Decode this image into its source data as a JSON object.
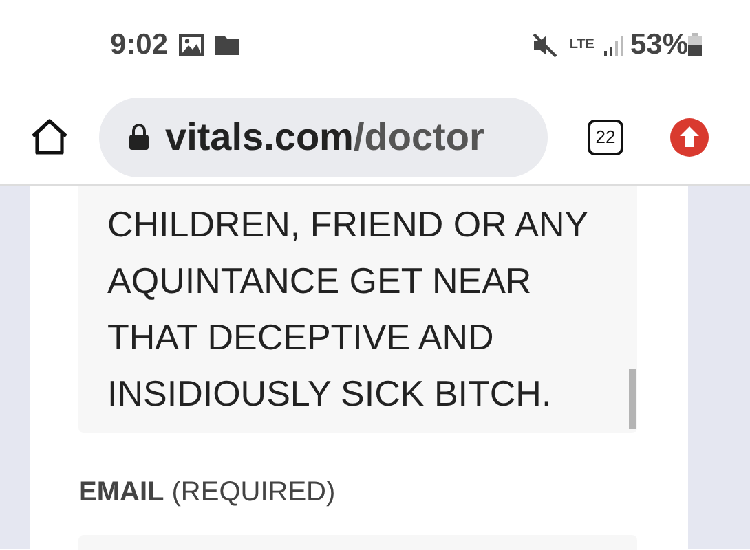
{
  "status_bar": {
    "time": "9:02",
    "network": "LTE",
    "battery": "53%"
  },
  "browser": {
    "url": "vitals.com/doctor",
    "tab_count": "22"
  },
  "form": {
    "review_lines": [
      "CHILDREN, FRIEND OR ANY",
      "AQUINTANCE GET NEAR",
      "THAT DECEPTIVE AND",
      "INSIDIOUSLY SICK BITCH."
    ],
    "email_label": {
      "name": "EMAIL",
      "note": "(REQUIRED)"
    }
  }
}
